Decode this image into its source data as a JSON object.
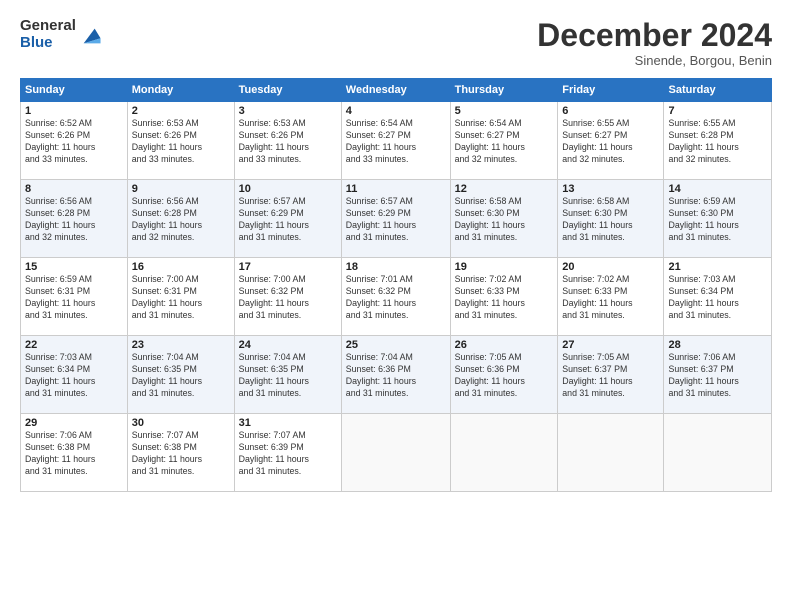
{
  "logo": {
    "general": "General",
    "blue": "Blue"
  },
  "title": "December 2024",
  "subtitle": "Sinende, Borgou, Benin",
  "days_header": [
    "Sunday",
    "Monday",
    "Tuesday",
    "Wednesday",
    "Thursday",
    "Friday",
    "Saturday"
  ],
  "weeks": [
    [
      {
        "day": "1",
        "content": "Sunrise: 6:52 AM\nSunset: 6:26 PM\nDaylight: 11 hours\nand 33 minutes."
      },
      {
        "day": "2",
        "content": "Sunrise: 6:53 AM\nSunset: 6:26 PM\nDaylight: 11 hours\nand 33 minutes."
      },
      {
        "day": "3",
        "content": "Sunrise: 6:53 AM\nSunset: 6:26 PM\nDaylight: 11 hours\nand 33 minutes."
      },
      {
        "day": "4",
        "content": "Sunrise: 6:54 AM\nSunset: 6:27 PM\nDaylight: 11 hours\nand 33 minutes."
      },
      {
        "day": "5",
        "content": "Sunrise: 6:54 AM\nSunset: 6:27 PM\nDaylight: 11 hours\nand 32 minutes."
      },
      {
        "day": "6",
        "content": "Sunrise: 6:55 AM\nSunset: 6:27 PM\nDaylight: 11 hours\nand 32 minutes."
      },
      {
        "day": "7",
        "content": "Sunrise: 6:55 AM\nSunset: 6:28 PM\nDaylight: 11 hours\nand 32 minutes."
      }
    ],
    [
      {
        "day": "8",
        "content": "Sunrise: 6:56 AM\nSunset: 6:28 PM\nDaylight: 11 hours\nand 32 minutes."
      },
      {
        "day": "9",
        "content": "Sunrise: 6:56 AM\nSunset: 6:28 PM\nDaylight: 11 hours\nand 32 minutes."
      },
      {
        "day": "10",
        "content": "Sunrise: 6:57 AM\nSunset: 6:29 PM\nDaylight: 11 hours\nand 31 minutes."
      },
      {
        "day": "11",
        "content": "Sunrise: 6:57 AM\nSunset: 6:29 PM\nDaylight: 11 hours\nand 31 minutes."
      },
      {
        "day": "12",
        "content": "Sunrise: 6:58 AM\nSunset: 6:30 PM\nDaylight: 11 hours\nand 31 minutes."
      },
      {
        "day": "13",
        "content": "Sunrise: 6:58 AM\nSunset: 6:30 PM\nDaylight: 11 hours\nand 31 minutes."
      },
      {
        "day": "14",
        "content": "Sunrise: 6:59 AM\nSunset: 6:30 PM\nDaylight: 11 hours\nand 31 minutes."
      }
    ],
    [
      {
        "day": "15",
        "content": "Sunrise: 6:59 AM\nSunset: 6:31 PM\nDaylight: 11 hours\nand 31 minutes."
      },
      {
        "day": "16",
        "content": "Sunrise: 7:00 AM\nSunset: 6:31 PM\nDaylight: 11 hours\nand 31 minutes."
      },
      {
        "day": "17",
        "content": "Sunrise: 7:00 AM\nSunset: 6:32 PM\nDaylight: 11 hours\nand 31 minutes."
      },
      {
        "day": "18",
        "content": "Sunrise: 7:01 AM\nSunset: 6:32 PM\nDaylight: 11 hours\nand 31 minutes."
      },
      {
        "day": "19",
        "content": "Sunrise: 7:02 AM\nSunset: 6:33 PM\nDaylight: 11 hours\nand 31 minutes."
      },
      {
        "day": "20",
        "content": "Sunrise: 7:02 AM\nSunset: 6:33 PM\nDaylight: 11 hours\nand 31 minutes."
      },
      {
        "day": "21",
        "content": "Sunrise: 7:03 AM\nSunset: 6:34 PM\nDaylight: 11 hours\nand 31 minutes."
      }
    ],
    [
      {
        "day": "22",
        "content": "Sunrise: 7:03 AM\nSunset: 6:34 PM\nDaylight: 11 hours\nand 31 minutes."
      },
      {
        "day": "23",
        "content": "Sunrise: 7:04 AM\nSunset: 6:35 PM\nDaylight: 11 hours\nand 31 minutes."
      },
      {
        "day": "24",
        "content": "Sunrise: 7:04 AM\nSunset: 6:35 PM\nDaylight: 11 hours\nand 31 minutes."
      },
      {
        "day": "25",
        "content": "Sunrise: 7:04 AM\nSunset: 6:36 PM\nDaylight: 11 hours\nand 31 minutes."
      },
      {
        "day": "26",
        "content": "Sunrise: 7:05 AM\nSunset: 6:36 PM\nDaylight: 11 hours\nand 31 minutes."
      },
      {
        "day": "27",
        "content": "Sunrise: 7:05 AM\nSunset: 6:37 PM\nDaylight: 11 hours\nand 31 minutes."
      },
      {
        "day": "28",
        "content": "Sunrise: 7:06 AM\nSunset: 6:37 PM\nDaylight: 11 hours\nand 31 minutes."
      }
    ],
    [
      {
        "day": "29",
        "content": "Sunrise: 7:06 AM\nSunset: 6:38 PM\nDaylight: 11 hours\nand 31 minutes."
      },
      {
        "day": "30",
        "content": "Sunrise: 7:07 AM\nSunset: 6:38 PM\nDaylight: 11 hours\nand 31 minutes."
      },
      {
        "day": "31",
        "content": "Sunrise: 7:07 AM\nSunset: 6:39 PM\nDaylight: 11 hours\nand 31 minutes."
      },
      {
        "day": "",
        "content": ""
      },
      {
        "day": "",
        "content": ""
      },
      {
        "day": "",
        "content": ""
      },
      {
        "day": "",
        "content": ""
      }
    ]
  ]
}
